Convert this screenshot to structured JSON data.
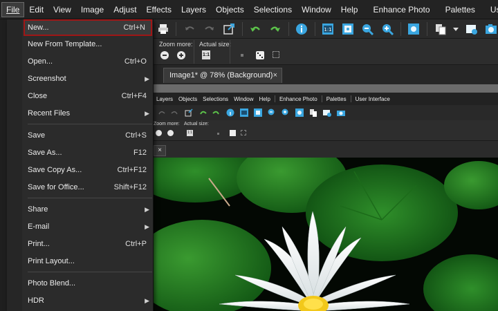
{
  "menubar": {
    "items": [
      "File",
      "Edit",
      "View",
      "Image",
      "Adjust",
      "Effects",
      "Layers",
      "Objects",
      "Selections",
      "Window",
      "Help",
      "Enhance Photo",
      "Palettes",
      "User Interface"
    ]
  },
  "file_menu": {
    "items": [
      {
        "label": "New...",
        "shortcut": "Ctrl+N"
      },
      {
        "label": "New From Template...",
        "shortcut": ""
      },
      {
        "label": "Open...",
        "shortcut": "Ctrl+O"
      },
      {
        "label": "Screenshot",
        "shortcut": ""
      },
      {
        "label": "Close",
        "shortcut": "Ctrl+F4"
      },
      {
        "label": "Recent Files",
        "shortcut": ""
      },
      {
        "label": "Save",
        "shortcut": "Ctrl+S"
      },
      {
        "label": "Save As...",
        "shortcut": "F12"
      },
      {
        "label": "Save Copy As...",
        "shortcut": "Ctrl+F12"
      },
      {
        "label": "Save for Office...",
        "shortcut": "Shift+F12"
      },
      {
        "label": "Share",
        "shortcut": ""
      },
      {
        "label": "E-mail",
        "shortcut": ""
      },
      {
        "label": "Print...",
        "shortcut": "Ctrl+P"
      },
      {
        "label": "Print Layout...",
        "shortcut": ""
      },
      {
        "label": "Photo Blend...",
        "shortcut": ""
      },
      {
        "label": "HDR",
        "shortcut": ""
      }
    ],
    "submenu_arrow": "▶"
  },
  "toolbar": {
    "zoom_more_label": "Zoom more:",
    "actual_size_label": "Actual size:",
    "actual_size_button": "1:1"
  },
  "document": {
    "tab_title": "Image1* @  78% (Background)",
    "close_glyph": "×"
  },
  "inner_window": {
    "menu_items": [
      "Layers",
      "Objects",
      "Selections",
      "Window",
      "Help",
      "Enhance Photo",
      "Palettes",
      "User Interface"
    ],
    "zoom_more_label": "Zoom more:",
    "actual_size_label": "Actual size:",
    "actual_size_button": "1:1",
    "tab_close_glyph": "×"
  },
  "colors": {
    "accent_highlight": "#a01616",
    "toolbar_icon_blue": "#3aa6e0",
    "toolbar_icon_green": "#5cc24a"
  }
}
